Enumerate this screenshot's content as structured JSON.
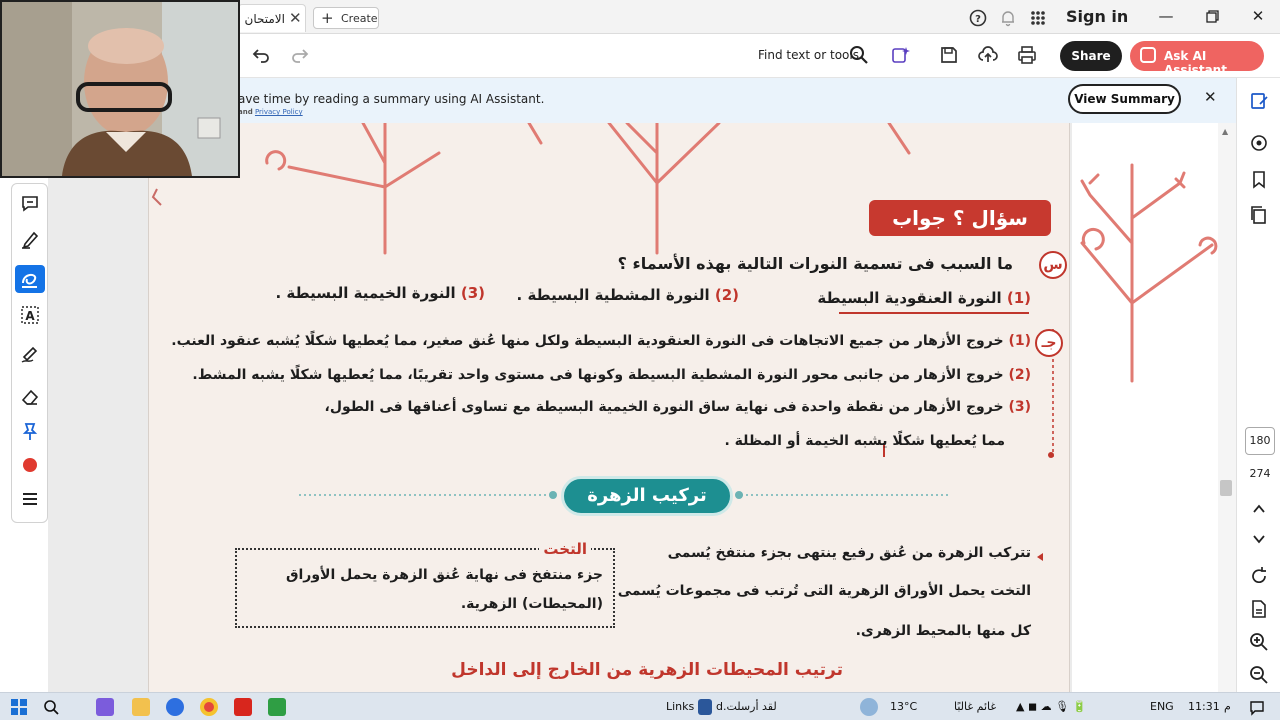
{
  "tabbar": {
    "tab_title": "الامتحان",
    "create_label": "Create",
    "sign_in": "Sign in"
  },
  "toolbar": {
    "find_text": "Find text or tools",
    "share": "Share",
    "ai_assistant": "Ask AI Assistant"
  },
  "banner": {
    "message": "ave time by reading a summary using AI Assistant.",
    "privacy_prefix": "and",
    "privacy_link": "Privacy Policy",
    "view_summary": "View Summary"
  },
  "navigation": {
    "current_page": "180",
    "total_pages": "274"
  },
  "document": {
    "question_badge": "سؤال ؟ جواب",
    "q_marker": "س",
    "question": "ما السبب فى تسمية النورات التالية بهذه الأسماء ؟",
    "options": [
      {
        "num": "(1)",
        "text": "النورة العنقودية البسيطة"
      },
      {
        "num": "(2)",
        "text": "النورة المشطية البسيطة ."
      },
      {
        "num": "(3)",
        "text": "النورة الخيمية البسيطة ."
      }
    ],
    "a_marker": "جـ",
    "answers": [
      {
        "num": "(1)",
        "text": "خروج الأزهار من جميع الاتجاهات فى النورة العنقودية البسيطة ولكل منها عُنق صغير، مما يُعطيها شكلًا يُشبه عنقود العنب."
      },
      {
        "num": "(2)",
        "text": "خروج الأزهار من جانبى محور النورة المشطية البسيطة وكونها فى مستوى واحد تقريبًا، مما يُعطيها شكلًا يشبه المشط."
      },
      {
        "num": "(3)",
        "text": "خروج الأزهار من نقطة واحدة فى نهاية ساق النورة الخيمية البسيطة مع تساوى أعناقها فى الطول،"
      }
    ],
    "answer3_cont": "مما يُعطيها شكلًا يشبه الخيمة أو المظلة .",
    "section_title": "تركيب الزهرة",
    "body_lines": [
      "تتركب الزهرة من عُنق رفيع ينتهى بجزء منتفخ يُسمى",
      "التخت يحمل الأوراق الزهرية التى تُرتب فى مجموعات يُسمى",
      "كل منها بالمحيط الزهرى."
    ],
    "def_title": "التخت",
    "def_text_1": "جزء منتفخ فى نهاية عُنق الزهرة يحمل الأوراق",
    "def_text_2": "(المحيطات) الزهرية.",
    "bottom_heading": "ترتيب المحيطات الزهرية من الخارج إلى الداخل"
  },
  "taskbar": {
    "links": "Links",
    "doc_title": "لقد أرسلت.d",
    "temperature": "13°C",
    "weather": "غائم غالبًا",
    "language": "ENG",
    "time": "11:31",
    "ampm": "م"
  }
}
